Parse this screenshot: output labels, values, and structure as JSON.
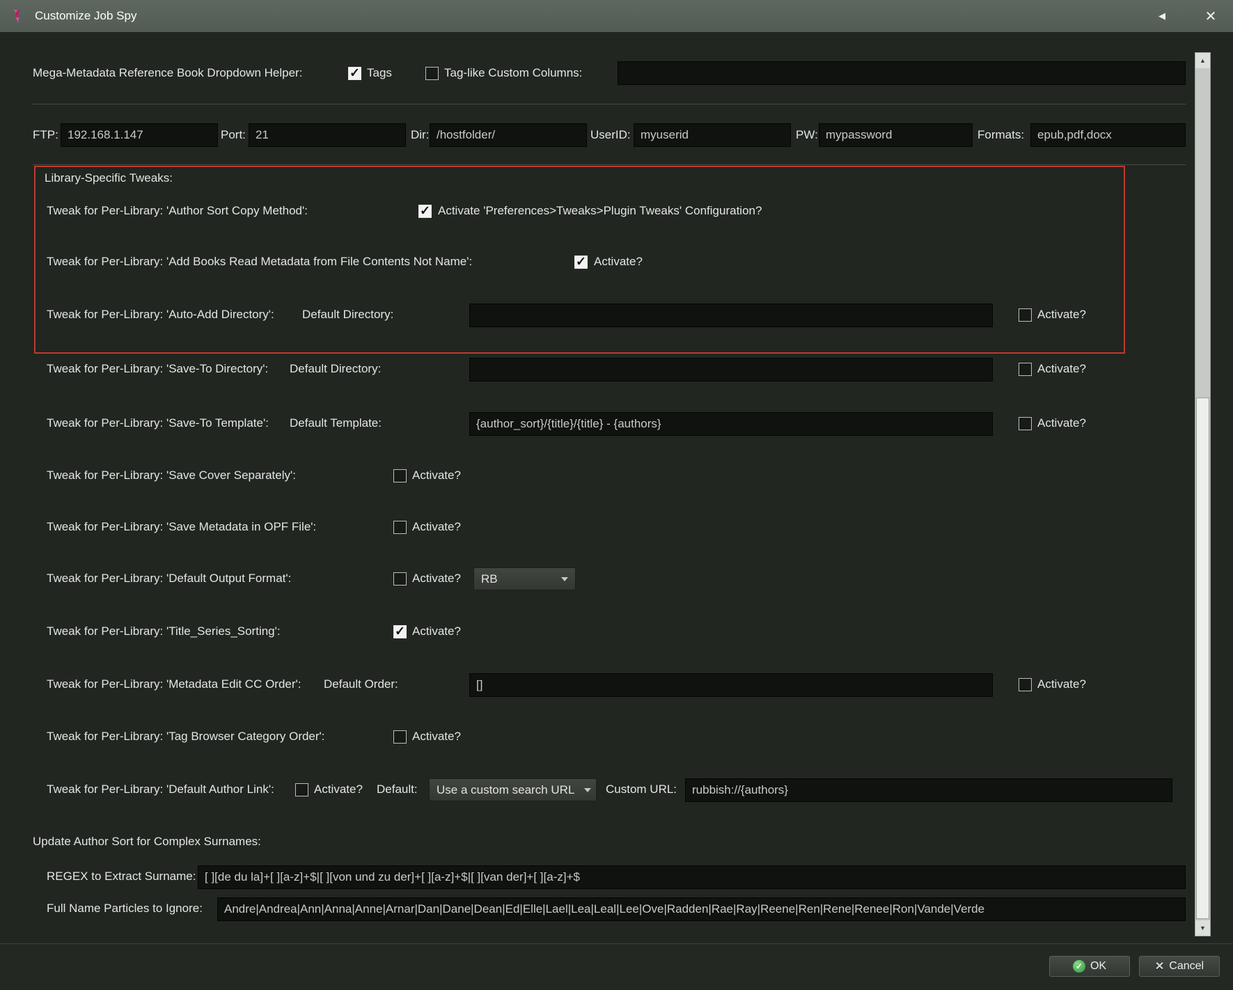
{
  "window": {
    "title": "Customize Job Spy"
  },
  "icons": {
    "collapse": "◀",
    "close": "✕",
    "scroll_up": "▲",
    "scroll_down": "▼",
    "ok_check": "✓",
    "cancel_x": "✕"
  },
  "helper": {
    "label": "Mega-Metadata Reference Book Dropdown Helper:",
    "tags_label": "Tags",
    "tags_checked": true,
    "tag_like_label": "Tag-like Custom Columns:",
    "tag_like_checked": false,
    "tag_like_value": ""
  },
  "ftp": {
    "ftp_label": "FTP:",
    "ftp_value": "192.168.1.147",
    "port_label": "Port:",
    "port_value": "21",
    "dir_label": "Dir:",
    "dir_value": "/hostfolder/",
    "userid_label": "UserID:",
    "userid_value": "myuserid",
    "pw_label": "PW:",
    "pw_value": "mypassword",
    "formats_label": "Formats:",
    "formats_value": "epub,pdf,docx"
  },
  "tweaks": {
    "heading": "Library-Specific Tweaks:",
    "author_sort_copy": {
      "label": "Tweak for Per-Library: 'Author Sort Copy Method':",
      "activate_label": "Activate 'Preferences>Tweaks>Plugin Tweaks' Configuration?",
      "checked": true
    },
    "add_books_read": {
      "label": "Tweak for Per-Library: 'Add Books Read Metadata from File Contents Not Name':",
      "activate_label": "Activate?",
      "checked": true
    },
    "auto_add_dir": {
      "label": "Tweak for Per-Library: 'Auto-Add Directory':",
      "field_label": "Default Directory:",
      "value": "",
      "activate_label": "Activate?",
      "checked": false
    },
    "save_to_dir": {
      "label": "Tweak for Per-Library: 'Save-To Directory':",
      "field_label": "Default Directory:",
      "value": "",
      "activate_label": "Activate?",
      "checked": false
    },
    "save_to_template": {
      "label": "Tweak for Per-Library: 'Save-To Template':",
      "field_label": "Default Template:",
      "value": "{author_sort}/{title}/{title} - {authors}",
      "activate_label": "Activate?",
      "checked": false
    },
    "save_cover": {
      "label": "Tweak for Per-Library: 'Save Cover Separately':",
      "activate_label": "Activate?",
      "checked": false
    },
    "save_opf": {
      "label": "Tweak for Per-Library: 'Save Metadata in OPF File':",
      "activate_label": "Activate?",
      "checked": false
    },
    "default_output": {
      "label": "Tweak for Per-Library: 'Default Output Format':",
      "activate_label": "Activate?",
      "checked": false,
      "format_value": "RB"
    },
    "title_series": {
      "label": "Tweak for Per-Library: 'Title_Series_Sorting':",
      "activate_label": "Activate?",
      "checked": true
    },
    "metadata_cc": {
      "label": "Tweak for Per-Library: 'Metadata Edit CC Order':",
      "field_label": "Default Order:",
      "value": "[]",
      "activate_label": "Activate?",
      "checked": false
    },
    "tag_browser": {
      "label": "Tweak for Per-Library: 'Tag Browser Category Order':",
      "activate_label": "Activate?",
      "checked": false
    },
    "author_link": {
      "label": "Tweak for Per-Library: 'Default Author Link':",
      "activate_label": "Activate?",
      "checked": false,
      "default_label": "Default:",
      "dropdown_value": "Use a custom search URL",
      "custom_url_label": "Custom URL:",
      "custom_url_value": "rubbish://{authors}"
    }
  },
  "author_sort": {
    "heading": "Update Author Sort for Complex Surnames:",
    "regex_label": "REGEX to Extract Surname:",
    "regex_value": "[ ][de du la]+[ ][a-z]+$|[ ][von und zu der]+[ ][a-z]+$|[ ][van der]+[ ][a-z]+$",
    "particles_label": "Full Name Particles to Ignore:",
    "particles_value": "Andre|Andrea|Ann|Anna|Anne|Arnar|Dan|Dane|Dean|Ed|Elle|Lael|Lea|Leal|Lee|Ove|Radden|Rae|Ray|Reene|Ren|Rene|Renee|Ron|Vande|Verde"
  },
  "footer": {
    "ok_label": "OK",
    "cancel_label": "Cancel"
  },
  "colors": {
    "titlebar": "#58625a",
    "background": "#212621",
    "field_bg": "#0f120f",
    "highlight_red": "#bf3a2b",
    "ok_green": "#43a047",
    "app_icon_pink": "#e94aa2"
  }
}
